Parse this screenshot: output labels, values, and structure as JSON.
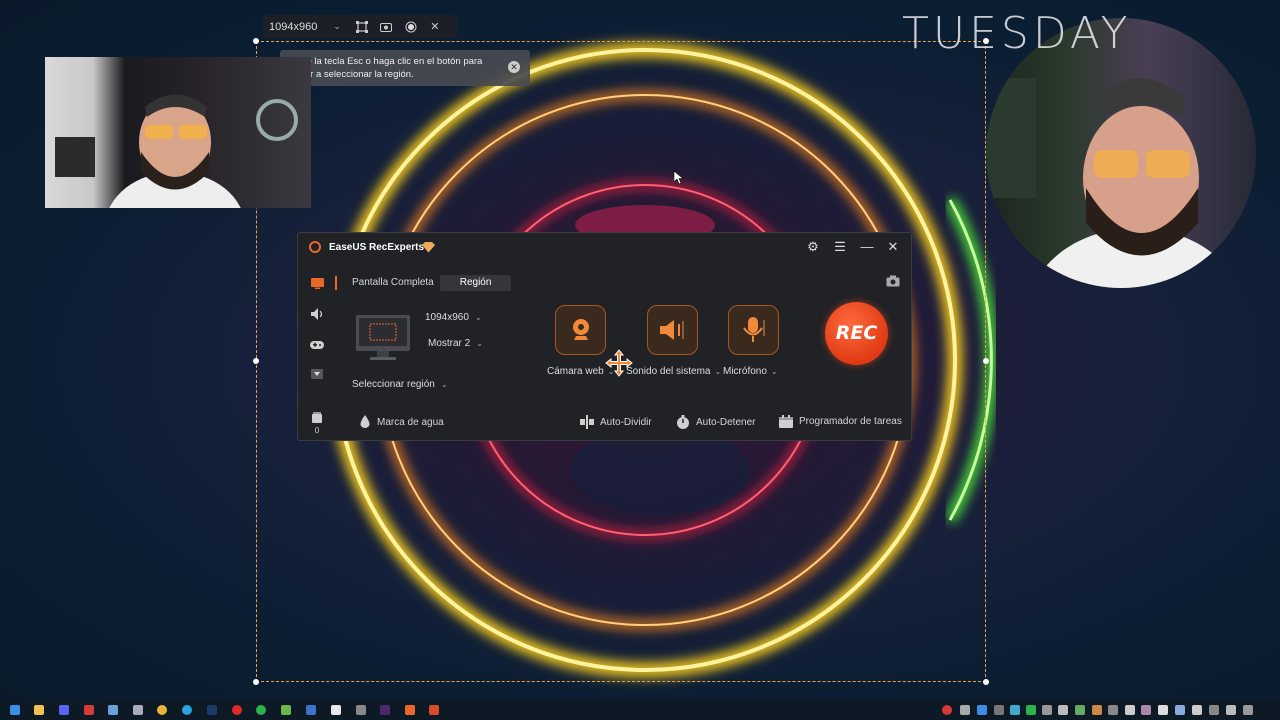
{
  "region_toolbar": {
    "size_value": "1094x960",
    "icons": [
      "dropdown-icon",
      "region-select-icon",
      "screenshot-icon",
      "record-dot-icon",
      "close-icon"
    ]
  },
  "tooltip": {
    "text": "Pulse la tecla Esc o haga clic en el botón para volver a seleccionar la región."
  },
  "brand_overlay": "TUESDAY",
  "app": {
    "title": "EaseUS RecExperts",
    "tabs": [
      "Pantalla Completa",
      "Región"
    ],
    "active_tab": "Región",
    "resolution": "1094x960",
    "display": "Mostrar 2",
    "select_region": "Seleccionar región",
    "sources": [
      {
        "label": "Cámara web",
        "icon": "webcam-icon"
      },
      {
        "label": "Sonido del sistema",
        "icon": "speaker-icon"
      },
      {
        "label": "Micrófono",
        "icon": "microphone-icon"
      }
    ],
    "rec_label": "REC",
    "footer": {
      "watermark": "Marca de agua",
      "auto_split": "Auto-Dividir",
      "auto_stop": "Auto-Detener",
      "scheduler": "Programador de tareas"
    },
    "file_count": "0",
    "colors": {
      "accent": "#e8682a",
      "rec": "#e03a14",
      "window_bg": "#202226"
    }
  }
}
